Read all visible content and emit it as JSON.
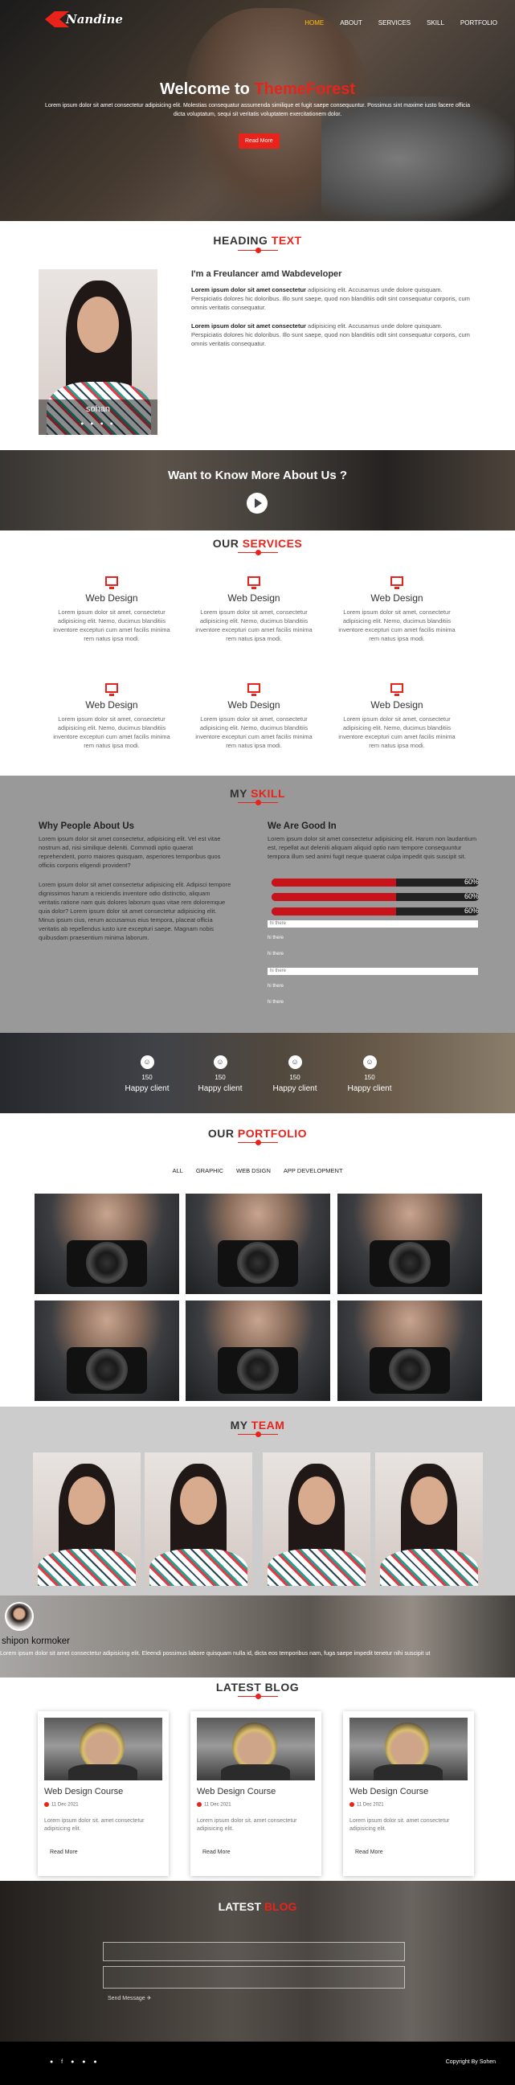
{
  "header": {
    "logo": "Nandine",
    "nav": [
      "HOME",
      "ABOUT",
      "SERVICES",
      "SKILL",
      "PORTFOLIO"
    ]
  },
  "hero": {
    "title_prefix": "Welcome to ",
    "title_highlight": "ThemeForest",
    "text": "Lorem ipsum dolor sit amet consectetur adipisicing elit. Molestias consequatur assumenda similique et fugit saepe consequuntur. Possimus sint maxime iusto facere officia dicta voluptatum, sequi sit veritatis voluptatem exercitationem dolor.",
    "button": "Read More"
  },
  "about": {
    "title_prefix": "HEADING ",
    "title_highlight": "TEXT",
    "name": "sohan",
    "socials": "● ● ● ●",
    "heading": "I'm a Freulancer amd Wabdeveloper",
    "para1_bold": "Lorem ipsum dolor sit amet consectetur",
    "para1": " adipisicing elit. Accusamus unde dolore quisquam. Perspiciatis dolores hic doloribus. Illo sunt saepe, quod non blanditiis odit sint consequatur corporis, cum omnis veritatis consequatur.",
    "para2_bold": "Lorem ipsum dolor sit amet consectetur",
    "para2": " adipisicing elit. Accusamus unde dolore quisquam. Perspiciatis dolores hic doloribus. Illo sunt saepe, quod non blanditiis odit sint consequatur corporis, cum omnis veritatis consequatur."
  },
  "video": {
    "title": "Want to Know More About Us ?"
  },
  "services": {
    "title_prefix": "OUR ",
    "title_highlight": "SERVICES",
    "items": [
      {
        "title": "Web Design",
        "text": "Lorem ipsum dolor sit amet, consectetur adipisicing elit. Nemo, ducimus blanditiis inventore excepturi cum amet facilis minima rem natus ipsa modi."
      },
      {
        "title": "Web Design",
        "text": "Lorem ipsum dolor sit amet, consectetur adipisicing elit. Nemo, ducimus blanditiis inventore excepturi cum amet facilis minima rem natus ipsa modi."
      },
      {
        "title": "Web Design",
        "text": "Lorem ipsum dolor sit amet, consectetur adipisicing elit. Nemo, ducimus blanditiis inventore excepturi cum amet facilis minima rem natus ipsa modi."
      },
      {
        "title": "Web Design",
        "text": "Lorem ipsum dolor sit amet, consectetur adipisicing elit. Nemo, ducimus blanditiis inventore excepturi cum amet facilis minima rem natus ipsa modi."
      },
      {
        "title": "Web Design",
        "text": "Lorem ipsum dolor sit amet, consectetur adipisicing elit. Nemo, ducimus blanditiis inventore excepturi cum amet facilis minima rem natus ipsa modi."
      },
      {
        "title": "Web Design",
        "text": "Lorem ipsum dolor sit amet, consectetur adipisicing elit. Nemo, ducimus blanditiis inventore excepturi cum amet facilis minima rem natus ipsa modi."
      }
    ]
  },
  "skill": {
    "title_prefix": "MY ",
    "title_highlight": "SKILL",
    "left_heading": "Why People About Us",
    "left_para1": "Lorem ipsum dolor sit amet consectetur, adipisicing elit. Vel est vitae nostrum ad, nisi similique deleniti. Commodi optio quaerat reprehenderit, porro maiores quisquam, asperiores temporibus quos officiis corporis eligendi provident?",
    "left_para2": "Lorem ipsum dolor sit amet consectetur adipisicing elit. Adipisci tempore dignissimos harum a reiciendis inventore odio distinctio, aliquam veritatis ratione nam quis dolores laborum quas vitae rem doloremque quia dolor? Lorem ipsum dolor sit amet consectetur adipisicing elit. Minus ipsum cius, rerum accusamus eius tempora, placeat officia veritatis ab repellendus iusto iure excepturi saepe. Magnam nobis quibusdam praesentium minima laborum.",
    "right_heading": "We Are Good In",
    "right_para": "Lorem ipsum dolor sit amet consectetur adipisicing elit. Harum non laudantium est, repellat aut deleniti aliquam aliquid optio nam tempore consequuntur tempora illum sed animi fugit neque quaerat culpa impedit quis suscipit sit.",
    "bars": [
      {
        "percent": 60,
        "label": "60%"
      },
      {
        "percent": 60,
        "label": "60%"
      },
      {
        "percent": 60,
        "label": "60%"
      }
    ],
    "fields": [
      "hi there",
      "hi there",
      "hi there",
      "hi there",
      "hi there",
      "hi there"
    ]
  },
  "counters": [
    {
      "num": "150",
      "label": "Happy client"
    },
    {
      "num": "150",
      "label": "Happy client"
    },
    {
      "num": "150",
      "label": "Happy client"
    },
    {
      "num": "150",
      "label": "Happy client"
    }
  ],
  "portfolio": {
    "title_prefix": "OUR ",
    "title_highlight": "PORTFOLIO",
    "filters": [
      "ALL",
      "GRAPHIC",
      "WEB DSIGN",
      "APP DEVELOPMENT"
    ]
  },
  "team": {
    "title_prefix": "MY ",
    "title_highlight": "TEAM"
  },
  "testimonial": {
    "name": "shipon kormoker",
    "text": "Lorem ipsum dolor sit amet consectetur adipisicing elit. Eleendi possimus labore quisquam nulla id, dicta eos temporibus nam, fuga saepe impedit tenetur nihi suscipit ut"
  },
  "blog": {
    "title": "LATEST BLOG",
    "cards": [
      {
        "title": "Web Design Course",
        "date": "11 Dec 2021",
        "text": "Lorem ipsum dolor sit. amet consectetur adipisicing elit.",
        "more": "Read More"
      },
      {
        "title": "Web Design Course",
        "date": "11 Dec 2021",
        "text": "Lorem ipsum dolor sit. amet consectetur adipisicing elit.",
        "more": "Read More"
      },
      {
        "title": "Web Design Course",
        "date": "11 Dec 2021",
        "text": "Lorem ipsum dolor sit. amet consectetur adipisicing elit.",
        "more": "Read More"
      }
    ]
  },
  "contact": {
    "title_prefix": "LATEST ",
    "title_highlight": "BLOG",
    "send": "Send Message ✈"
  },
  "footer": {
    "socials": "● f ● ● ●",
    "copyright": "Copyright By Sohen"
  }
}
